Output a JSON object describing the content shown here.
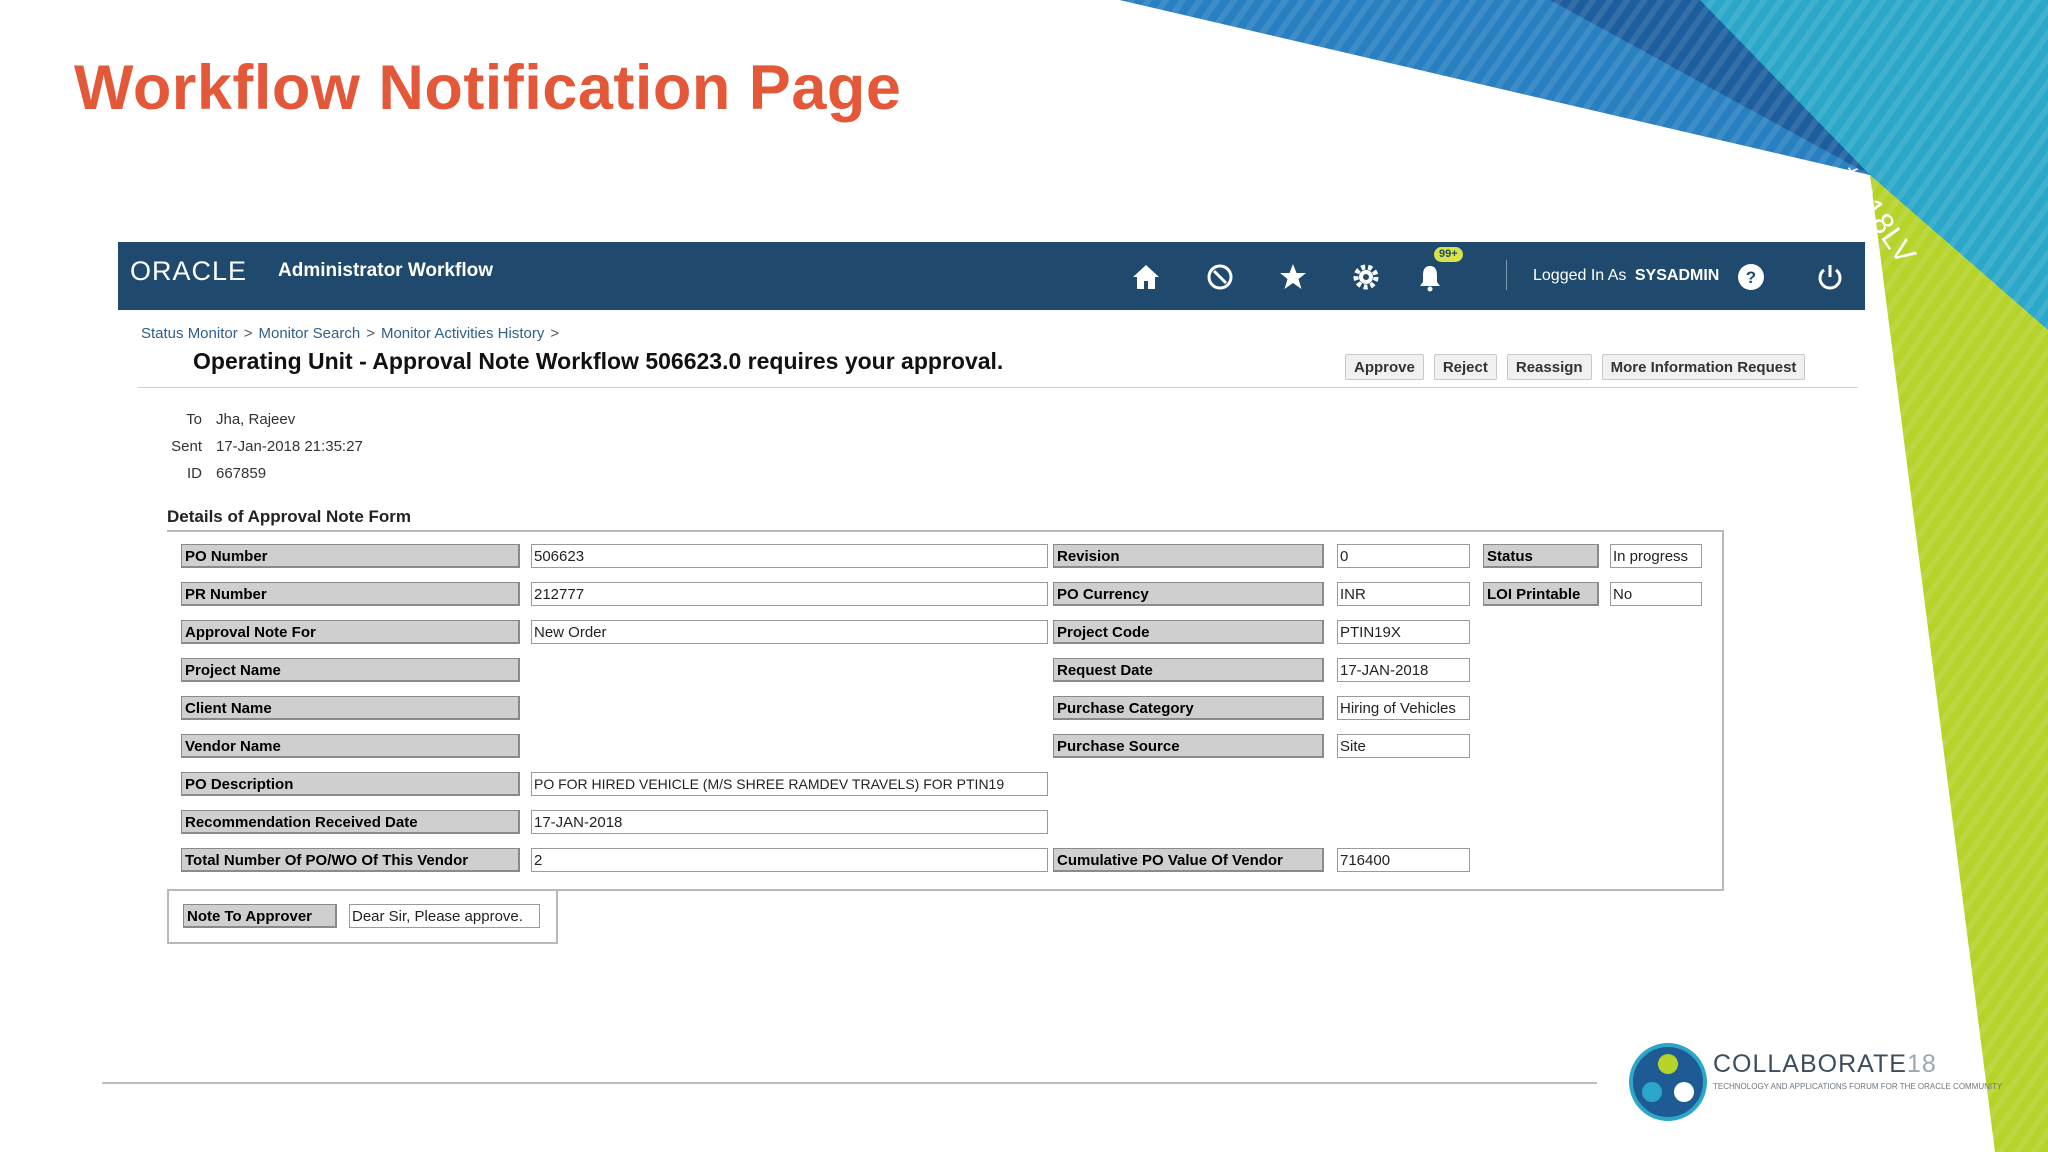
{
  "slide": {
    "title": "Workflow Notification Page",
    "hashtag": "#C18LV"
  },
  "app": {
    "logo": "ORACLE",
    "name": "Administrator Workflow",
    "header_icons": [
      "home-icon",
      "compass-icon",
      "star-icon",
      "gear-icon",
      "bell-icon"
    ],
    "notification_badge": "99+",
    "logged_in_prefix": "Logged In As",
    "user": "SYSADMIN"
  },
  "breadcrumb": [
    "Status Monitor",
    "Monitor Search",
    "Monitor Activities History"
  ],
  "breadcrumb_separator": ">",
  "page_heading": "Operating Unit - Approval Note Workflow 506623.0 requires your approval.",
  "actions": [
    "Approve",
    "Reject",
    "Reassign",
    "More Information Request"
  ],
  "meta": {
    "to_label": "To",
    "to_value": "Jha, Rajeev",
    "sent_label": "Sent",
    "sent_value": "17-Jan-2018 21:35:27",
    "id_label": "ID",
    "id_value": "667859"
  },
  "section_title": "Details of Approval Note Form",
  "form": {
    "po_number_label": "PO Number",
    "po_number": "506623",
    "revision_label": "Revision",
    "revision": "0",
    "status_label": "Status",
    "status": "In progress",
    "pr_number_label": "PR Number",
    "pr_number": "212777",
    "po_currency_label": "PO Currency",
    "po_currency": "INR",
    "loi_printable_label": "LOI Printable",
    "loi_printable": "No",
    "approval_note_for_label": "Approval Note For",
    "approval_note_for": "New Order",
    "project_code_label": "Project Code",
    "project_code": "PTIN19X",
    "project_name_label": "Project Name",
    "request_date_label": "Request Date",
    "request_date": "17-JAN-2018",
    "client_name_label": "Client Name",
    "purchase_category_label": "Purchase Category",
    "purchase_category": "Hiring of Vehicles",
    "vendor_name_label": "Vendor Name",
    "purchase_source_label": "Purchase Source",
    "purchase_source": "Site",
    "po_description_label": "PO Description",
    "po_description": "PO FOR HIRED VEHICLE (M/S SHREE RAMDEV TRAVELS) FOR PTIN19",
    "recommendation_date_label": "Recommendation Received Date",
    "recommendation_date": "17-JAN-2018",
    "total_po_label": "Total Number Of PO/WO Of This Vendor",
    "total_po": "2",
    "cumulative_po_label": "Cumulative PO Value Of Vendor",
    "cumulative_po": "716400",
    "note_label": "Note To Approver",
    "note": "Dear Sir, Please approve."
  },
  "branding": {
    "name": "COLLABORATE",
    "year": "18",
    "tagline": "TECHNOLOGY AND APPLICATIONS FORUM FOR THE ORACLE COMMUNITY"
  },
  "colors": {
    "title": "#e4583a",
    "header_bg": "#1f4a6e",
    "deco_blue": "#1d6fb0",
    "deco_teal": "#2aa7c9",
    "deco_green": "#b6d32a"
  }
}
